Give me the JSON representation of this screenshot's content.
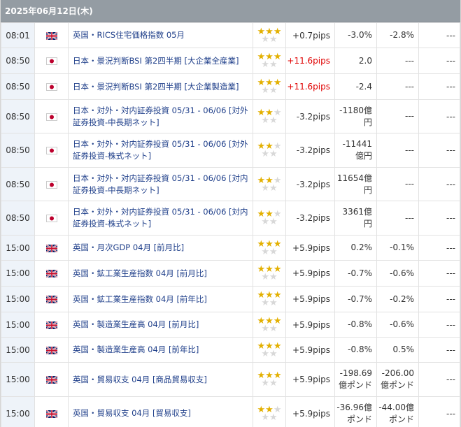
{
  "date_header": "2025年06月12日(木)",
  "colors": {
    "header_bg": "#949ca3",
    "time_bg": "#eef3f9",
    "link": "#1f3f8a",
    "positive": "#e00000",
    "star_on": "#e3b000",
    "star_off": "#d8d8d8"
  },
  "rows": [
    {
      "time": "08:01",
      "flag": "uk-flag-icon",
      "event": "英国・RICS住宅価格指数 05月",
      "stars": 3,
      "pips": "+0.7pips",
      "pips_red": false,
      "c1": "-3.0%",
      "c2": "-2.8%",
      "c3": "---"
    },
    {
      "time": "08:50",
      "flag": "jp-flag-icon",
      "event": "日本・景況判断BSI 第2四半期 [大企業全産業]",
      "stars": 3,
      "pips": "+11.6pips",
      "pips_red": true,
      "c1": "2.0",
      "c2": "---",
      "c3": "---"
    },
    {
      "time": "08:50",
      "flag": "jp-flag-icon",
      "event": "日本・景況判断BSI 第2四半期 [大企業製造業]",
      "stars": 3,
      "pips": "+11.6pips",
      "pips_red": true,
      "c1": "-2.4",
      "c2": "---",
      "c3": "---"
    },
    {
      "time": "08:50",
      "flag": "jp-flag-icon",
      "event": "日本・対外・対内証券投資 05/31 - 06/06 [対外証券投資-中長期ネット]",
      "stars": 2,
      "pips": "-3.2pips",
      "pips_red": false,
      "c1": "-1180億円",
      "c2": "---",
      "c3": "---"
    },
    {
      "time": "08:50",
      "flag": "jp-flag-icon",
      "event": "日本・対外・対内証券投資 05/31 - 06/06 [対外証券投資-株式ネット]",
      "stars": 2,
      "pips": "-3.2pips",
      "pips_red": false,
      "c1": "-11441億円",
      "c2": "---",
      "c3": "---"
    },
    {
      "time": "08:50",
      "flag": "jp-flag-icon",
      "event": "日本・対外・対内証券投資 05/31 - 06/06 [対内証券投資-中長期ネット]",
      "stars": 2,
      "pips": "-3.2pips",
      "pips_red": false,
      "c1": "11654億円",
      "c2": "---",
      "c3": "---"
    },
    {
      "time": "08:50",
      "flag": "jp-flag-icon",
      "event": "日本・対外・対内証券投資 05/31 - 06/06 [対内証券投資-株式ネット]",
      "stars": 2,
      "pips": "-3.2pips",
      "pips_red": false,
      "c1": "3361億円",
      "c2": "---",
      "c3": "---"
    },
    {
      "time": "15:00",
      "flag": "uk-flag-icon",
      "event": "英国・月次GDP 04月 [前月比]",
      "stars": 3,
      "pips": "+5.9pips",
      "pips_red": false,
      "c1": "0.2%",
      "c2": "-0.1%",
      "c3": "---"
    },
    {
      "time": "15:00",
      "flag": "uk-flag-icon",
      "event": "英国・鉱工業生産指数 04月 [前月比]",
      "stars": 3,
      "pips": "+5.9pips",
      "pips_red": false,
      "c1": "-0.7%",
      "c2": "-0.6%",
      "c3": "---"
    },
    {
      "time": "15:00",
      "flag": "uk-flag-icon",
      "event": "英国・鉱工業生産指数 04月 [前年比]",
      "stars": 3,
      "pips": "+5.9pips",
      "pips_red": false,
      "c1": "-0.7%",
      "c2": "-0.2%",
      "c3": "---"
    },
    {
      "time": "15:00",
      "flag": "uk-flag-icon",
      "event": "英国・製造業生産高 04月 [前月比]",
      "stars": 3,
      "pips": "+5.9pips",
      "pips_red": false,
      "c1": "-0.8%",
      "c2": "-0.6%",
      "c3": "---"
    },
    {
      "time": "15:00",
      "flag": "uk-flag-icon",
      "event": "英国・製造業生産高 04月 [前年比]",
      "stars": 3,
      "pips": "+5.9pips",
      "pips_red": false,
      "c1": "-0.8%",
      "c2": "0.5%",
      "c3": "---"
    },
    {
      "time": "15:00",
      "flag": "uk-flag-icon",
      "event": "英国・貿易収支 04月 [商品貿易収支]",
      "stars": 3,
      "pips": "+5.9pips",
      "pips_red": false,
      "c1": "-198.69億ポンド",
      "c2": "-206.00億ポンド",
      "c3": "---"
    },
    {
      "time": "15:00",
      "flag": "uk-flag-icon",
      "event": "英国・貿易収支 04月 [貿易収支]",
      "stars": 2,
      "pips": "+5.9pips",
      "pips_red": false,
      "c1": "-36.96億ポンド",
      "c2": "-44.00億ポンド",
      "c3": "---"
    }
  ]
}
